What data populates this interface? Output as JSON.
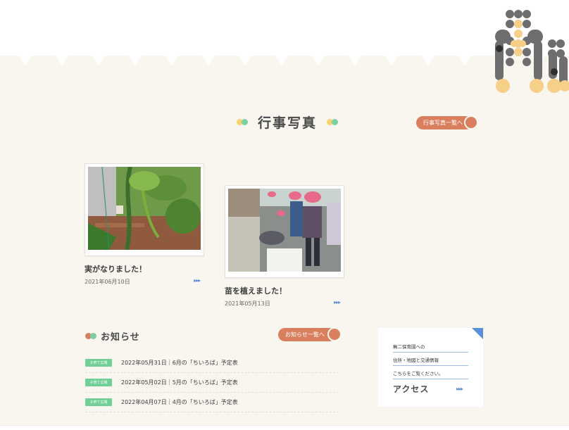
{
  "colors": {
    "background": "#f8f6ef",
    "accent": "#d97f5d",
    "green": "#7ccfa4",
    "yellow": "#f4d36b",
    "blue": "#5b8fd6",
    "tag_green": "#6fcf97"
  },
  "events": {
    "heading": "行事写真",
    "list_button": "行事写真一覧へ",
    "posts": [
      {
        "title": "実がなりました！",
        "date": "2021年06月10日",
        "image": "plant-vine-photo"
      },
      {
        "title": "苗を植えました！",
        "date": "2021年05月13日",
        "image": "children-planting-photo"
      }
    ]
  },
  "news": {
    "heading": "お知らせ",
    "list_button": "お知らせ一覧へ",
    "items": [
      {
        "tag": "子育て広場",
        "text": "2022年05月31日｜6月の「ちいろば」予定表"
      },
      {
        "tag": "子育て広場",
        "text": "2022年05月02日｜5月の「ちいろば」予定表"
      },
      {
        "tag": "子育て広場",
        "text": "2022年04月07日｜4月の「ちいろば」予定表"
      }
    ]
  },
  "access": {
    "line1": "無二保育園への",
    "line2": "住所・地図と交通情報",
    "line3": "こちらをご覧ください。",
    "label": "アクセス"
  },
  "icons": {
    "arrow": "▸▸▸"
  }
}
